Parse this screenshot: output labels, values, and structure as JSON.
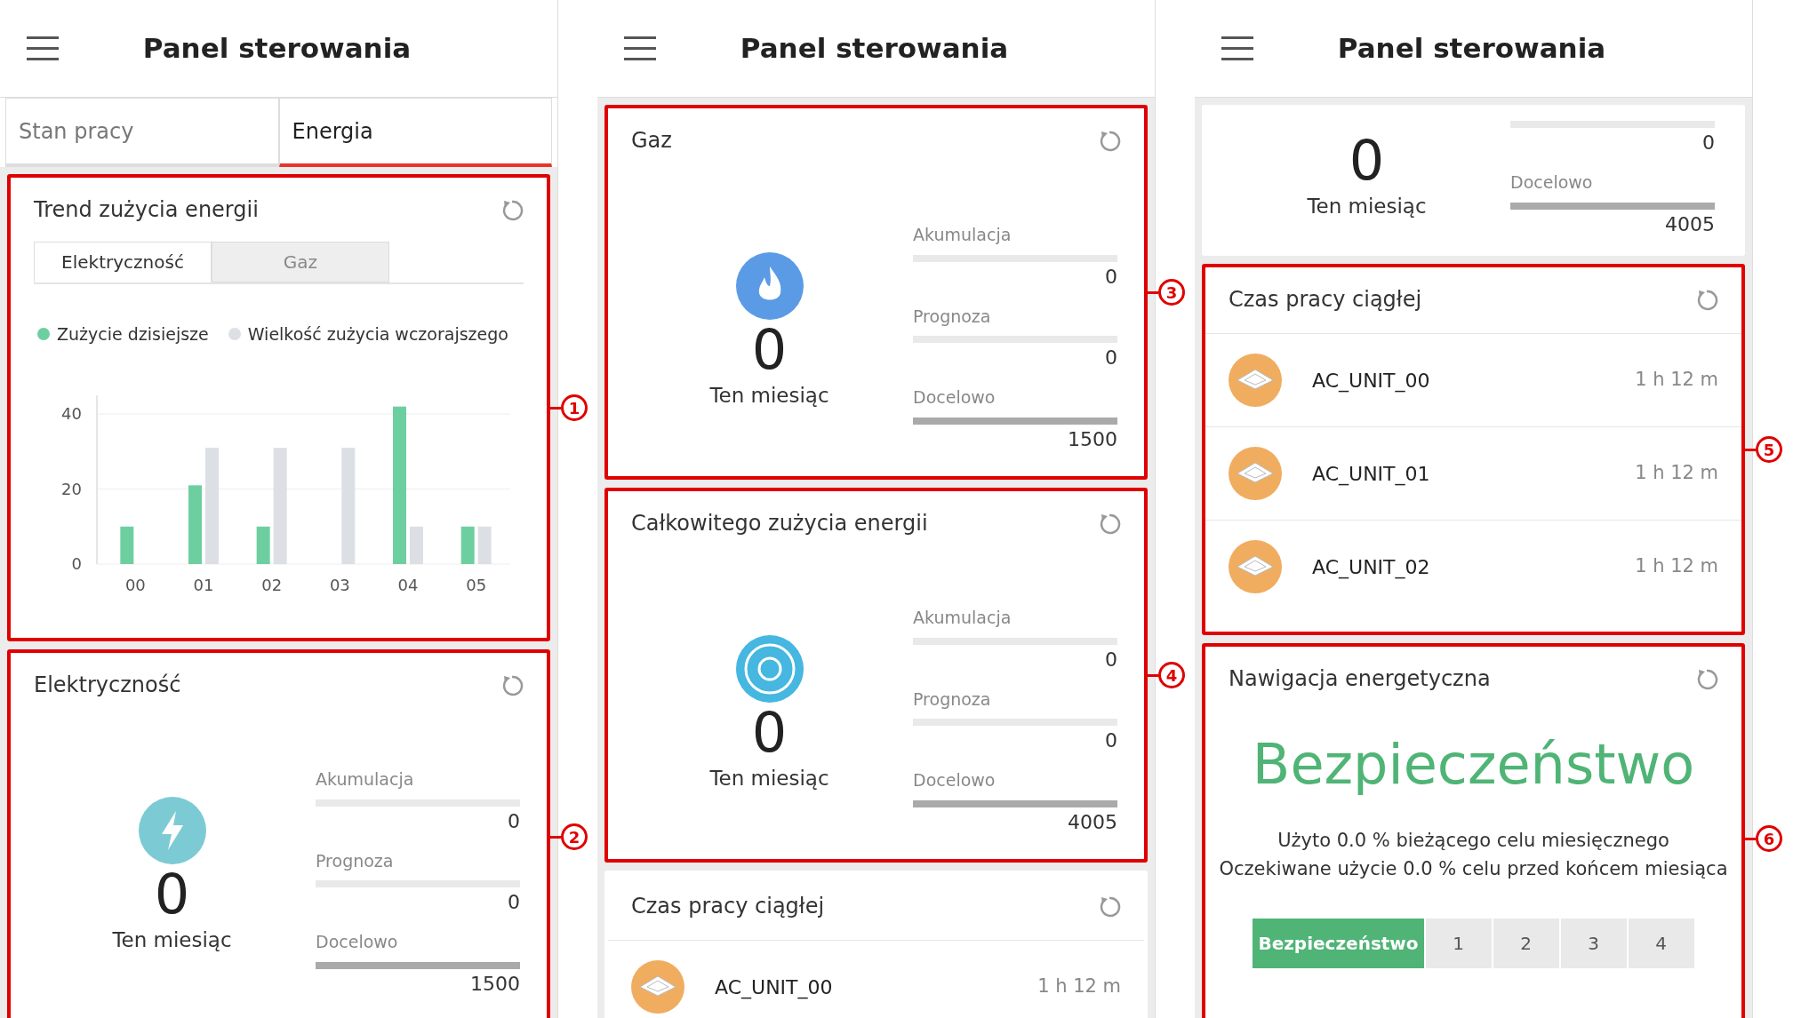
{
  "screens": [
    {
      "title": "Panel sterowania",
      "tabs": [
        {
          "label": "Stan pracy",
          "selected": false
        },
        {
          "label": "Energia",
          "selected": true
        }
      ],
      "cards": [
        {
          "kind": "trend",
          "title": "Trend zużycia energii",
          "callout": "1",
          "tabs": [
            {
              "label": "Elektryczność",
              "selected": true
            },
            {
              "label": "Gaz",
              "selected": false
            }
          ],
          "chart_data": {
            "type": "bar",
            "categories": [
              "00",
              "01",
              "02",
              "03",
              "04",
              "05"
            ],
            "series": [
              {
                "name": "Zużycie dzisiejsze",
                "color": "#6dcfa0",
                "values": [
                  10,
                  21,
                  10,
                  0,
                  42,
                  10
                ]
              },
              {
                "name": "Wielkość zużycia wczorajszego",
                "color": "#dcdfe4",
                "values": [
                  0,
                  31,
                  31,
                  31,
                  10,
                  10
                ]
              }
            ],
            "ylim": [
              0,
              45
            ],
            "yticks": [
              0,
              20,
              40
            ]
          }
        },
        {
          "kind": "meter",
          "title": "Elektryczność",
          "callout": "2",
          "value": "0",
          "caption": "Ten miesiąc",
          "meters": [
            {
              "label": "Akumulacja",
              "level": 0,
              "reading": "0"
            },
            {
              "label": "Prognoza",
              "level": 0,
              "reading": "0"
            },
            {
              "label": "Docelowo",
              "level": 1,
              "reading": "1500"
            }
          ]
        }
      ]
    },
    {
      "title": "Panel sterowania",
      "cards": [
        {
          "kind": "meter",
          "title": "Gaz",
          "callout": "3",
          "value": "0",
          "caption": "Ten miesiąc",
          "meters": [
            {
              "label": "Akumulacja",
              "level": 0,
              "reading": "0"
            },
            {
              "label": "Prognoza",
              "level": 0,
              "reading": "0"
            },
            {
              "label": "Docelowo",
              "level": 1,
              "reading": "1500"
            }
          ]
        },
        {
          "kind": "meter",
          "title": "Całkowitego zużycia energii",
          "callout": "4",
          "value": "0",
          "caption": "Ten miesiąc",
          "meters": [
            {
              "label": "Akumulacja",
              "level": 0,
              "reading": "0"
            },
            {
              "label": "Prognoza",
              "level": 0,
              "reading": "0"
            },
            {
              "label": "Docelowo",
              "level": 1,
              "reading": "4005"
            }
          ]
        },
        {
          "kind": "runtime",
          "title": "Czas pracy ciągłej",
          "units": [
            {
              "name": "AC_UNIT_00",
              "time": "1 h 12 m"
            }
          ]
        }
      ]
    },
    {
      "title": "Panel sterowania",
      "cards": [
        {
          "kind": "meter",
          "value": "0",
          "caption": "Ten miesiąc",
          "meters": [
            {
              "level": 0,
              "reading": "0"
            },
            {
              "label": "Docelowo",
              "level": 1,
              "reading": "4005"
            }
          ]
        },
        {
          "kind": "runtime",
          "title": "Czas pracy ciągłej",
          "callout": "5",
          "units": [
            {
              "name": "AC_UNIT_00",
              "time": "1 h 12 m"
            },
            {
              "name": "AC_UNIT_01",
              "time": "1 h 12 m"
            },
            {
              "name": "AC_UNIT_02",
              "time": "1 h 12 m"
            }
          ]
        },
        {
          "kind": "navigation",
          "title": "Nawigacja energetyczna",
          "callout": "6",
          "status": "Bezpieczeństwo",
          "lines": [
            "Użyto 0.0 % bieżącego celu miesięcznego",
            "Oczekiwane użycie 0.0 % celu przed końcem miesiąca"
          ],
          "levels": [
            {
              "label": "Bezpieczeństwo",
              "selected": true
            },
            {
              "label": "1",
              "selected": false
            },
            {
              "label": "2",
              "selected": false
            },
            {
              "label": "3",
              "selected": false
            },
            {
              "label": "4",
              "selected": false
            }
          ]
        }
      ]
    }
  ]
}
